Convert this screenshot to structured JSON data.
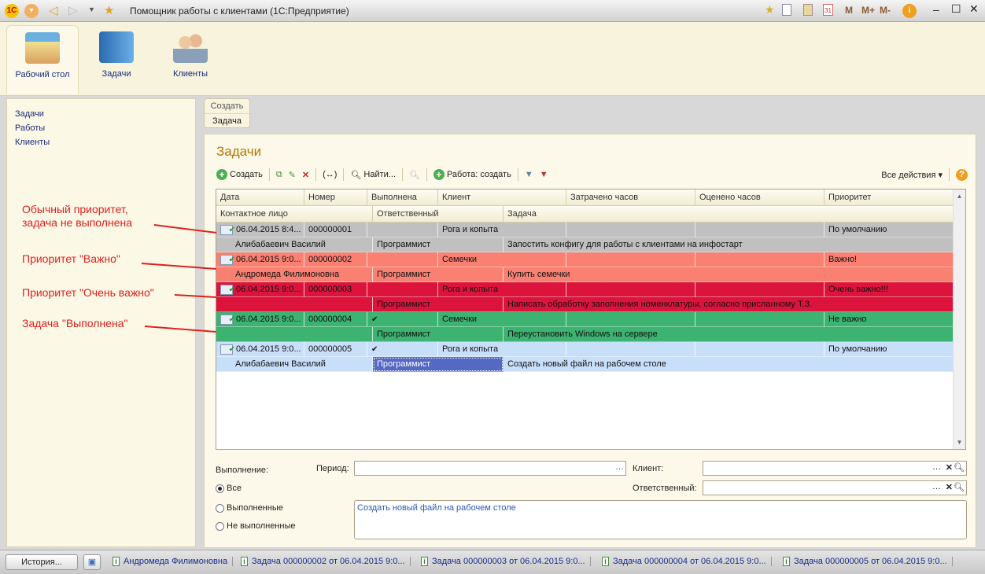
{
  "window": {
    "title": "Помощник работы с клиентами  (1С:Предприятие)",
    "memory": [
      "M",
      "M+",
      "M-"
    ]
  },
  "sections": [
    {
      "label": "Рабочий стол"
    },
    {
      "label": "Задачи"
    },
    {
      "label": "Клиенты"
    }
  ],
  "nav": [
    "Задачи",
    "Работы",
    "Клиенты"
  ],
  "command_panel": {
    "group": "Создать",
    "item": "Задача"
  },
  "form": {
    "title": "Задачи",
    "toolbar": {
      "create": "Создать",
      "find": "Найти...",
      "work_create": "Работа: создать",
      "all_actions": "Все действия ▾"
    }
  },
  "table": {
    "header1": [
      "Дата",
      "Номер",
      "Выполнена",
      "Клиент",
      "Затрачено часов",
      "Оценено часов",
      "Приоритет"
    ],
    "header2": [
      "Контактное лицо",
      "Ответственный",
      "Задача"
    ],
    "rows": [
      {
        "date": "06.04.2015 8:4...",
        "number": "000000001",
        "done": "",
        "client": "Рога и копыта",
        "spent": "",
        "estimated": "",
        "priority": "По умолчанию",
        "contact": "Алибабаевич Василий",
        "responsible": "Программист",
        "task": "Запостить конфигу для работы с клиентами на инфостарт",
        "color": "#c0c0c0",
        "text": "#111"
      },
      {
        "date": "06.04.2015 9:0...",
        "number": "000000002",
        "done": "",
        "client": "Семечки",
        "spent": "",
        "estimated": "",
        "priority": "Важно!",
        "contact": "Андромеда Филимоновна",
        "responsible": "Программист",
        "task": "Купить семечки",
        "color": "#fa8072",
        "text": "#111"
      },
      {
        "date": "06.04.2015 9:0...",
        "number": "000000003",
        "done": "",
        "client": "Рога и копыта",
        "spent": "",
        "estimated": "",
        "priority": "Очень важно!!!",
        "contact": "",
        "responsible": "Программист",
        "task": "Написать обработку заполнения номенклатуры, согласно присланному Т.З.",
        "color": "#dc143c",
        "text": "#111"
      },
      {
        "date": "06.04.2015 9:0...",
        "number": "000000004",
        "done": "✔",
        "client": "Семечки",
        "spent": "",
        "estimated": "",
        "priority": "Не важно",
        "contact": "",
        "responsible": "Программист",
        "task": "Переустановить Windows на сервере",
        "color": "#3cb371",
        "text": "#111"
      },
      {
        "date": "06.04.2015 9:0...",
        "number": "000000005",
        "done": "✔",
        "client": "Рога и копыта",
        "spent": "",
        "estimated": "",
        "priority": "По умолчанию",
        "contact": "Алибабаевич Василий",
        "responsible": "Программист",
        "task": "Создать новый файл на рабочем столе",
        "color": "#c8dffa",
        "text": "#111",
        "selected_cell": "responsible"
      }
    ]
  },
  "annotations": [
    "Обычный приоритет, задача не выполнена",
    "Приоритет \"Важно\"",
    "Приоритет \"Очень важно\"",
    "Задача \"Выполнена\""
  ],
  "filters": {
    "execution_label": "Выполнение:",
    "period_label": "Период:",
    "period_value": "",
    "client_label": "Клиент:",
    "client_value": "",
    "responsible_label": "Ответственный:",
    "responsible_value": "",
    "options": [
      "Все",
      "Выполненные",
      "Не выполненные"
    ],
    "selected": "Все",
    "task_text": "Создать новый файл на рабочем столе"
  },
  "taskbar": {
    "history": "История...",
    "windows": [
      "Андромеда Филимоновна",
      "Задача 000000002 от 06.04.2015 9:0...",
      "Задача 000000003 от 06.04.2015 9:0...",
      "Задача 000000004 от 06.04.2015 9:0...",
      "Задача 000000005 от 06.04.2015 9:0..."
    ]
  }
}
